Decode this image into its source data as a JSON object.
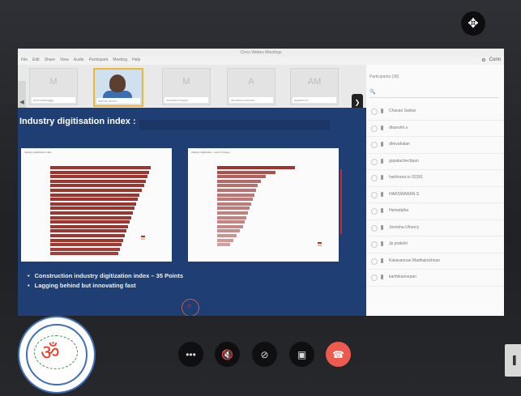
{
  "webex": {
    "title": "Cisco Webex Meetings",
    "menu": [
      "File",
      "Edit",
      "Share",
      "View",
      "Audio",
      "Participant",
      "Meeting",
      "Help"
    ],
    "top_right": "Conn"
  },
  "thumbnails": [
    {
      "initials": "M",
      "name": "kurkumburgge",
      "active": false
    },
    {
      "initials": "",
      "name": "karthik.adam",
      "active": true
    },
    {
      "initials": "M",
      "name": "madhavcheppe",
      "active": false
    },
    {
      "initials": "A",
      "name": "anurada siduvan",
      "active": false
    },
    {
      "initials": "AM",
      "name": "ayalam m",
      "active": false
    }
  ],
  "slide": {
    "title": "Industry digitisation index :",
    "bullets": [
      "Construction industry digitization index – 35 Points",
      "Lagging behind but innovating fast"
    ],
    "chart_left": {
      "header": "Industry digitization index"
    },
    "chart_right": {
      "header": "Industry digitization - rate of change"
    }
  },
  "participants_panel": {
    "title": "Participants (38)",
    "search_icon": "search-icon",
    "items": [
      "Chavan Sarkar",
      "dhanshri.s",
      "dhevahalan",
      "gopalachechpari",
      "harihrana rs 02391",
      "HARSWARAN.S",
      "Hemalatha",
      "Jemisha Ufrancy",
      "Jp prakshi",
      "Kalaivannan Madhakrishnan",
      "karthikanvepan"
    ]
  },
  "controls": [
    {
      "icon": "more-icon",
      "glyph": "•••"
    },
    {
      "icon": "mute-mic-icon",
      "glyph": "🎙"
    },
    {
      "icon": "video-off-icon",
      "glyph": "▢"
    },
    {
      "icon": "share-icon",
      "glyph": "↗"
    },
    {
      "icon": "end-call-icon",
      "glyph": "☎"
    }
  ],
  "colors": {
    "end_call": "#ef5a4f",
    "slide_bg": "#1f3f74",
    "bar": "#a0342f"
  }
}
